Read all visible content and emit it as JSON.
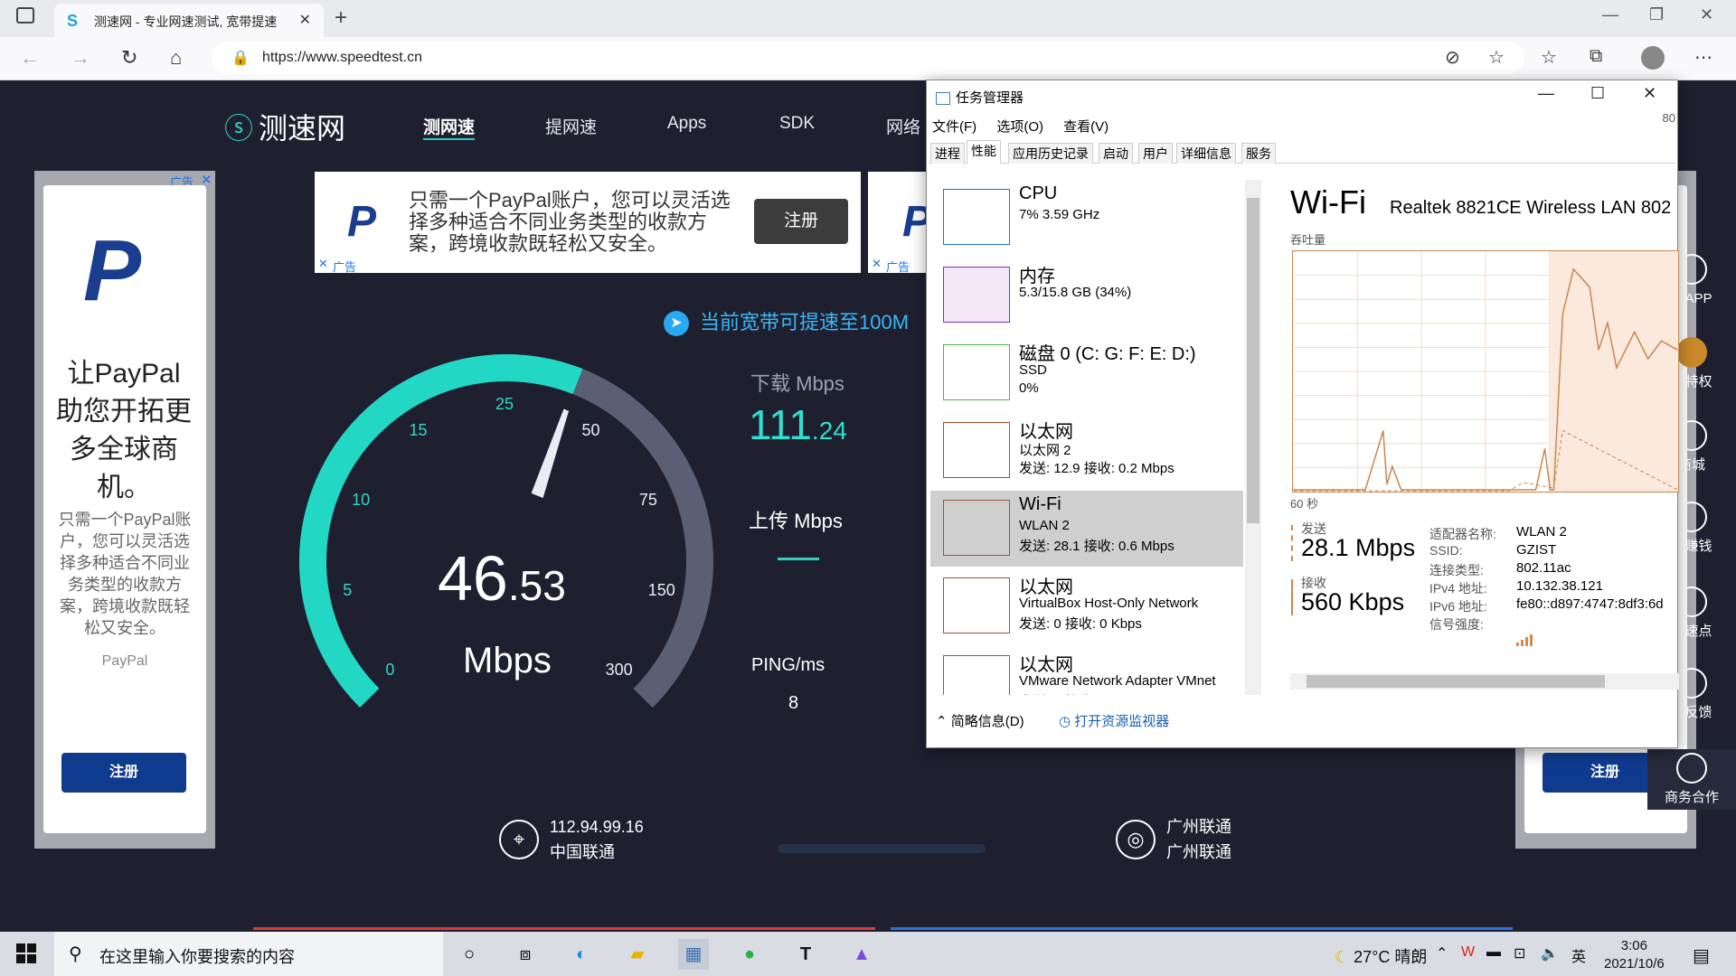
{
  "browser": {
    "tab_title": "测速网 - 专业网速测试, 宽带提速",
    "url": "https://www.speedtest.cn"
  },
  "site": {
    "logo": "测速网",
    "nav": [
      "测网速",
      "提网速",
      "Apps",
      "SDK",
      "网络"
    ],
    "boost_text": "当前宽带可提速至100M"
  },
  "ads": {
    "ad_label": "广告",
    "left_title": "让PayPal助您开拓更多全球商机。",
    "left_body": "只需一个PayPal账户，您可以灵活选择多种适合不同业务类型的收款方案，跨境收款既轻松又安全。",
    "left_brand": "PayPal",
    "register": "注册",
    "top_text": "只需一个PayPal账户，您可以灵活选择多种适合不同业务类型的收款方案，跨境收款既轻松又安全。"
  },
  "gauge": {
    "ticks": [
      "0",
      "5",
      "10",
      "15",
      "25",
      "50",
      "75",
      "150",
      "300"
    ],
    "value_int": "46",
    "value_dec": ".53",
    "unit": "Mbps",
    "progress": 0.58
  },
  "stats": {
    "download_label": "下载 Mbps",
    "download_int": "111",
    "download_dec": ".24",
    "upload_label": "上传 Mbps",
    "ping_label": "PING/ms",
    "ping_value": "8",
    "ip": "112.94.99.16",
    "isp": "中国联通",
    "server1": "广州联通",
    "server2": "广州联通"
  },
  "side_float": [
    "载APP",
    "员特权",
    "商城",
    "松赚钱",
    "测速点",
    "动反馈",
    "商务合作"
  ],
  "task_manager": {
    "title": "任务管理器",
    "menu": [
      "文件(F)",
      "选项(O)",
      "查看(V)"
    ],
    "tabs": [
      "进程",
      "性能",
      "应用历史记录",
      "启动",
      "用户",
      "详细信息",
      "服务"
    ],
    "rows": [
      {
        "name": "CPU",
        "sub1": "7% 3.59 GHz",
        "sub2": "",
        "color": "#1e73be"
      },
      {
        "name": "内存",
        "sub1": "5.3/15.8 GB (34%)",
        "sub2": "",
        "color": "#8b2bb5"
      },
      {
        "name": "磁盘 0 (C: G: F: E: D:)",
        "sub1": "SSD",
        "sub2": "0%",
        "color": "#4caf50"
      },
      {
        "name": "以太网",
        "sub1": "以太网 2",
        "sub2": "发送: 12.9 接收: 0.2 Mbps",
        "color": "#a0522d"
      },
      {
        "name": "Wi-Fi",
        "sub1": "WLAN 2",
        "sub2": "发送: 28.1 接收: 0.6 Mbps",
        "color": "#a0522d"
      },
      {
        "name": "以太网",
        "sub1": "VirtualBox Host-Only Network",
        "sub2": "发送: 0 接收: 0 Kbps",
        "color": "#a0522d"
      },
      {
        "name": "以太网",
        "sub1": "VMware Network Adapter VMnet",
        "sub2": "发送: 0 接收: 0 Kbps",
        "color": "#a0522d"
      }
    ],
    "footer_brief": "简略信息(D)",
    "footer_monitor": "打开资源监视器",
    "detail": {
      "title": "Wi-Fi",
      "adapter": "Realtek 8821CE Wireless LAN 802",
      "throughput": "吞吐量",
      "time_span": "60 秒",
      "corner": "80",
      "send_label": "发送",
      "send_value": "28.1 Mbps",
      "recv_label": "接收",
      "recv_value": "560 Kbps",
      "props": [
        {
          "k": "适配器名称:",
          "v": "WLAN 2"
        },
        {
          "k": "SSID:",
          "v": "GZIST"
        },
        {
          "k": "连接类型:",
          "v": "802.11ac"
        },
        {
          "k": "IPv4 地址:",
          "v": "10.132.38.121"
        },
        {
          "k": "IPv6 地址:",
          "v": "fe80::d897:4747:8df3:6d"
        },
        {
          "k": "信号强度:",
          "v": ""
        }
      ]
    }
  },
  "taskbar": {
    "search_placeholder": "在这里输入你要搜索的内容",
    "weather": "27°C  晴朗",
    "ime": "英",
    "time": "3:06",
    "date": "2021/10/6"
  }
}
